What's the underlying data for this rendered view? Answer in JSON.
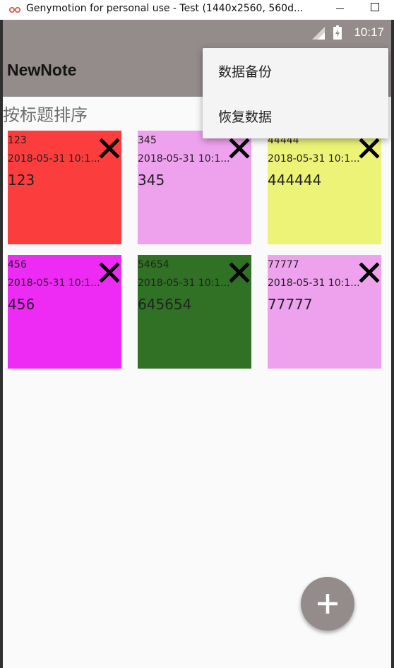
{
  "window": {
    "title": "Genymotion for personal use - Test (1440x2560, 560d..."
  },
  "status_bar": {
    "time": "10:17"
  },
  "app_bar": {
    "title": "NewNote"
  },
  "sort": {
    "label": "按标题排序"
  },
  "menu": {
    "items": [
      {
        "label": "数据备份"
      },
      {
        "label": "恢复数据"
      }
    ]
  },
  "notes": [
    {
      "title": "123",
      "date": "2018-05-31 10:1...",
      "content": "123",
      "color": "#fb3d3e"
    },
    {
      "title": "345",
      "date": "2018-05-31 10:1...",
      "content": "345",
      "color": "#eea2ee"
    },
    {
      "title": "44444",
      "date": "2018-05-31 10:1...",
      "content": "444444",
      "color": "#ecf377"
    },
    {
      "title": "456",
      "date": "2018-05-31 10:1...",
      "content": "456",
      "color": "#ee2af5"
    },
    {
      "title": "54654",
      "date": "2018-05-31 10:1...",
      "content": "645654",
      "color": "#307126"
    },
    {
      "title": "77777",
      "date": "2018-05-31 10:1...",
      "content": "77777",
      "color": "#eea2ee"
    }
  ],
  "colors": {
    "app_bar": "#948c8b",
    "fab": "#948c8b",
    "screen_bg": "#fafafa"
  }
}
